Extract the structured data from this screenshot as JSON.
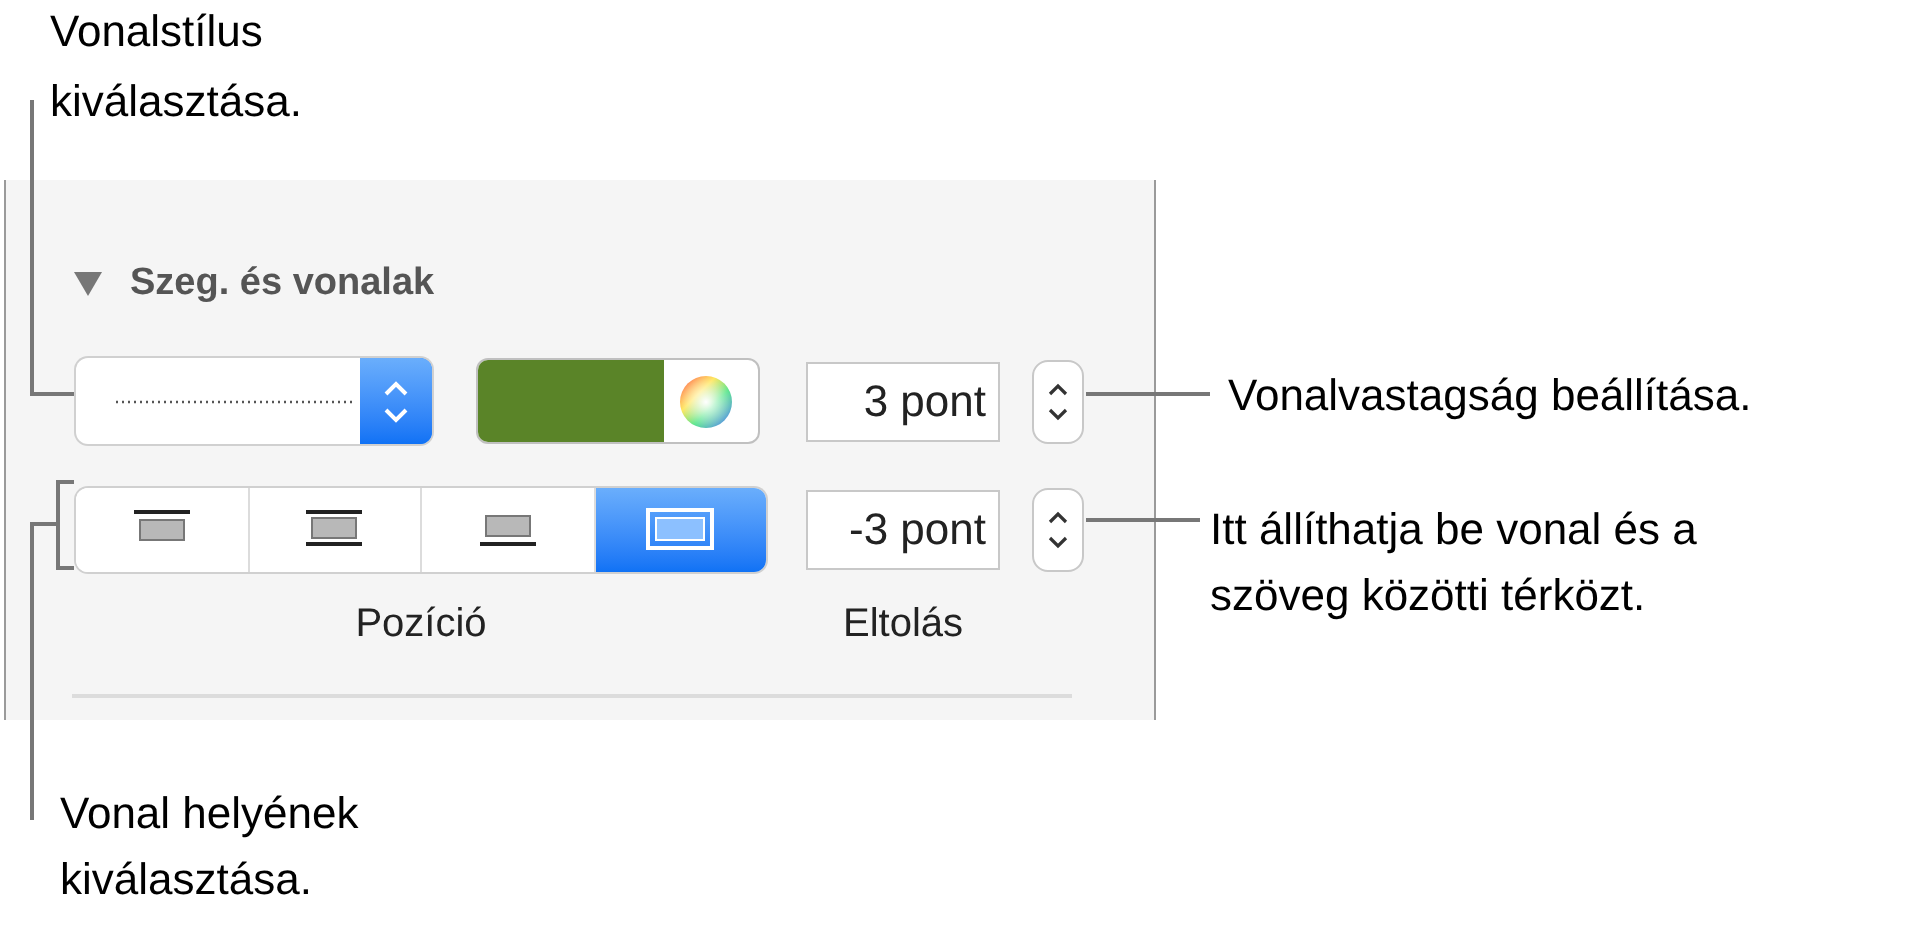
{
  "panel": {
    "section": {
      "title": "Szeg. és vonalak",
      "expanded": true
    },
    "line_style": {
      "kind": "dotted"
    },
    "color_well": {
      "color": "#5a8428"
    },
    "width_field": {
      "value": "3 pont"
    },
    "position_segments": [
      {
        "kind": "top",
        "selected": false
      },
      {
        "kind": "middle",
        "selected": false
      },
      {
        "kind": "bottom",
        "selected": false
      },
      {
        "kind": "around",
        "selected": true
      }
    ],
    "offset_field": {
      "value": "-3 pont"
    },
    "labels": [
      "Pozíció",
      "Eltolás"
    ]
  },
  "callouts": [
    {
      "text": "Vonalstílus\nkiválasztása."
    },
    {
      "text": "Vonalvastagság beállítása."
    },
    {
      "text": "Itt állíthatja be vonal és a\nszöveg közötti térközt."
    },
    {
      "text": "Vonal helyének\nkiválasztása."
    }
  ]
}
